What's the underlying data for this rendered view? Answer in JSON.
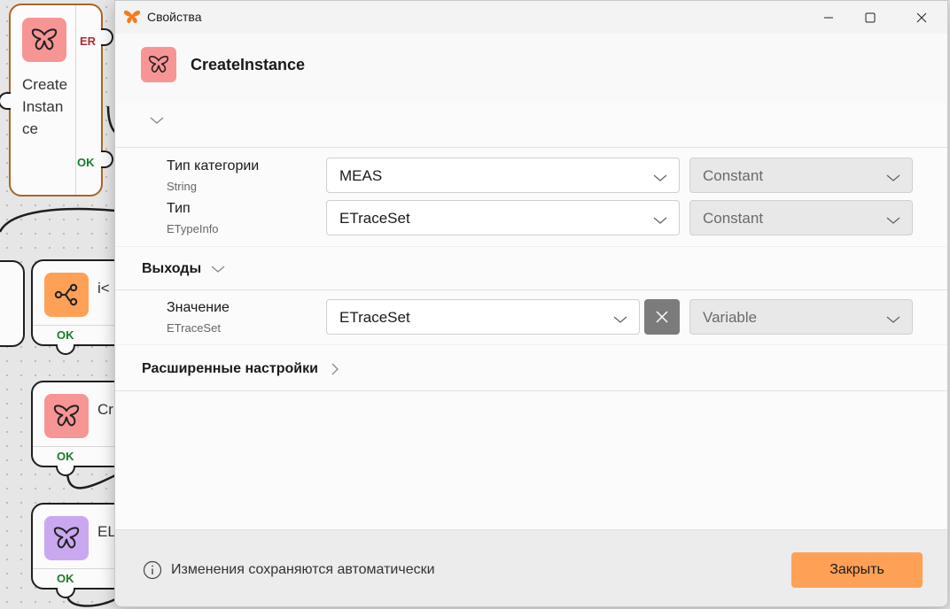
{
  "canvas": {
    "nodes": [
      {
        "label": "Create Instance",
        "lines": [
          "Create",
          "Instan",
          "ce"
        ],
        "er_label": "ER",
        "ok_label": "OK",
        "icon": "butterfly-icon",
        "color": "#f79595"
      },
      {
        "label": "i<",
        "ok_label": "OK",
        "icon": "branch-icon",
        "color": "#ffa057"
      },
      {
        "label": "Cr",
        "ok_label": "OK",
        "icon": "butterfly-icon",
        "color": "#f79595"
      },
      {
        "label": "EL",
        "ok_label": "OK",
        "icon": "butterfly-icon",
        "color": "#c9a8f0"
      }
    ]
  },
  "dialog": {
    "window_title": "Свойства",
    "app_icon": "butterfly-logo-icon",
    "header": {
      "title": "CreateInstance",
      "icon": "butterfly-icon",
      "icon_color": "#f79595"
    },
    "inputs_section": {
      "rows": [
        {
          "label": "Тип категории",
          "type": "String",
          "value": "MEAS",
          "mode": "Constant"
        },
        {
          "label": "Тип",
          "type": "ETypeInfo",
          "value": "ETraceSet",
          "mode": "Constant"
        }
      ]
    },
    "outputs_section": {
      "title": "Выходы",
      "rows": [
        {
          "label": "Значение",
          "type": "ETraceSet",
          "value": "ETraceSet",
          "mode": "Variable"
        }
      ]
    },
    "advanced_section": {
      "title": "Расширенные настройки"
    },
    "footer": {
      "info_text": "Изменения сохраняются автоматически",
      "close_label": "Закрыть"
    },
    "colors": {
      "accent": "#ffa057",
      "node_red": "#f79595",
      "node_purple": "#c9a8f0",
      "ok_green": "#1b7a2a",
      "er_red": "#b03030"
    }
  }
}
